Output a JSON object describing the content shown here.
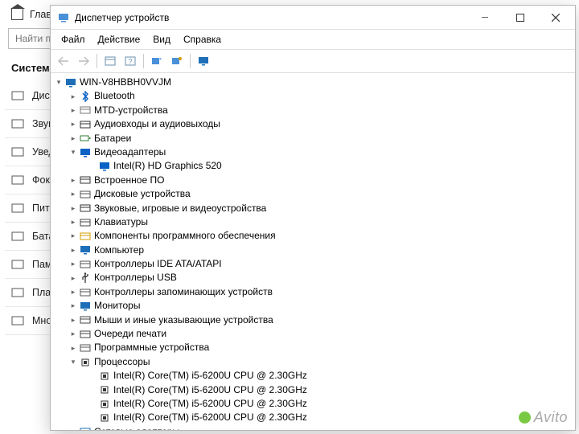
{
  "bg": {
    "home": "Главная",
    "search_placeholder": "Найти параметр",
    "section": "Система",
    "items": [
      "Дисплей",
      "Звук",
      "Уведомления",
      "Фокусировка",
      "Питание",
      "Батарея",
      "Память",
      "Планшет",
      "Многозадачность"
    ]
  },
  "dm": {
    "title": "Диспетчер устройств",
    "menu": {
      "file": "Файл",
      "action": "Действие",
      "view": "Вид",
      "help": "Справка"
    },
    "root": "WIN-V8HBBH0VVJM",
    "categories": [
      {
        "label": "Bluetooth",
        "icon": "i-bt",
        "expanded": false
      },
      {
        "label": "MTD-устройства",
        "icon": "i-generic",
        "expanded": false
      },
      {
        "label": "Аудиовходы и аудиовыходы",
        "icon": "i-audio",
        "expanded": false
      },
      {
        "label": "Батареи",
        "icon": "i-battery",
        "expanded": false
      },
      {
        "label": "Видеоадаптеры",
        "icon": "i-display",
        "expanded": true,
        "children": [
          {
            "label": "Intel(R) HD Graphics 520",
            "icon": "i-display"
          }
        ]
      },
      {
        "label": "Встроенное ПО",
        "icon": "i-firmware",
        "expanded": false
      },
      {
        "label": "Дисковые устройства",
        "icon": "i-disk",
        "expanded": false
      },
      {
        "label": "Звуковые, игровые и видеоустройства",
        "icon": "i-sound",
        "expanded": false
      },
      {
        "label": "Клавиатуры",
        "icon": "i-kbd",
        "expanded": false
      },
      {
        "label": "Компоненты программного обеспечения",
        "icon": "i-sw",
        "expanded": false
      },
      {
        "label": "Компьютер",
        "icon": "i-comp",
        "expanded": false
      },
      {
        "label": "Контроллеры IDE ATA/ATAPI",
        "icon": "i-ide",
        "expanded": false
      },
      {
        "label": "Контроллеры USB",
        "icon": "i-usb",
        "expanded": false
      },
      {
        "label": "Контроллеры запоминающих устройств",
        "icon": "i-storage",
        "expanded": false
      },
      {
        "label": "Мониторы",
        "icon": "i-mon",
        "expanded": false
      },
      {
        "label": "Мыши и иные указывающие устройства",
        "icon": "i-mouse",
        "expanded": false
      },
      {
        "label": "Очереди печати",
        "icon": "i-print",
        "expanded": false
      },
      {
        "label": "Программные устройства",
        "icon": "i-prog",
        "expanded": false
      },
      {
        "label": "Процессоры",
        "icon": "i-cpu",
        "expanded": true,
        "children": [
          {
            "label": "Intel(R) Core(TM) i5-6200U CPU @ 2.30GHz",
            "icon": "i-cpu"
          },
          {
            "label": "Intel(R) Core(TM) i5-6200U CPU @ 2.30GHz",
            "icon": "i-cpu"
          },
          {
            "label": "Intel(R) Core(TM) i5-6200U CPU @ 2.30GHz",
            "icon": "i-cpu"
          },
          {
            "label": "Intel(R) Core(TM) i5-6200U CPU @ 2.30GHz",
            "icon": "i-cpu"
          }
        ]
      },
      {
        "label": "Сетевые адаптеры",
        "icon": "i-net",
        "expanded": false
      }
    ]
  },
  "watermark": "Avito"
}
